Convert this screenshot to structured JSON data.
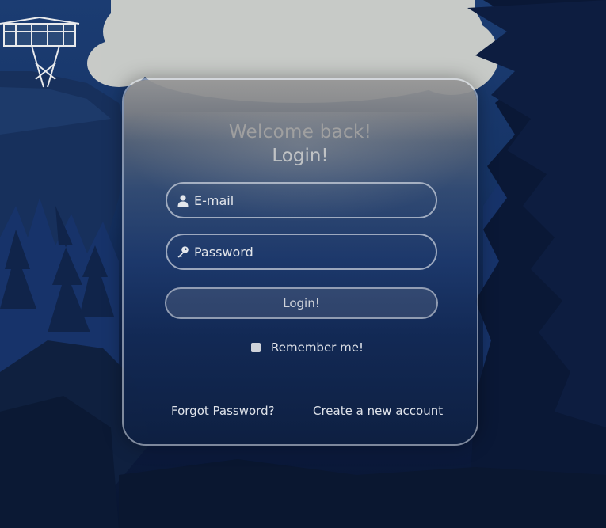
{
  "background": {
    "sky_color": "#1b3c72",
    "cloud_color": "#cfd0cb",
    "forest_color": "#0b1a3c"
  },
  "login_panel": {
    "welcome_text": "Welcome back!",
    "title": "Login!",
    "email_field": {
      "placeholder": "E-mail",
      "value": "",
      "icon": "user-icon"
    },
    "password_field": {
      "placeholder": "Password",
      "value": "",
      "icon": "key-icon"
    },
    "submit_label": "Login!",
    "remember_me": {
      "label": "Remember me!",
      "checked": false
    },
    "forgot_password_label": "Forgot Password?",
    "create_account_label": "Create a new account"
  }
}
